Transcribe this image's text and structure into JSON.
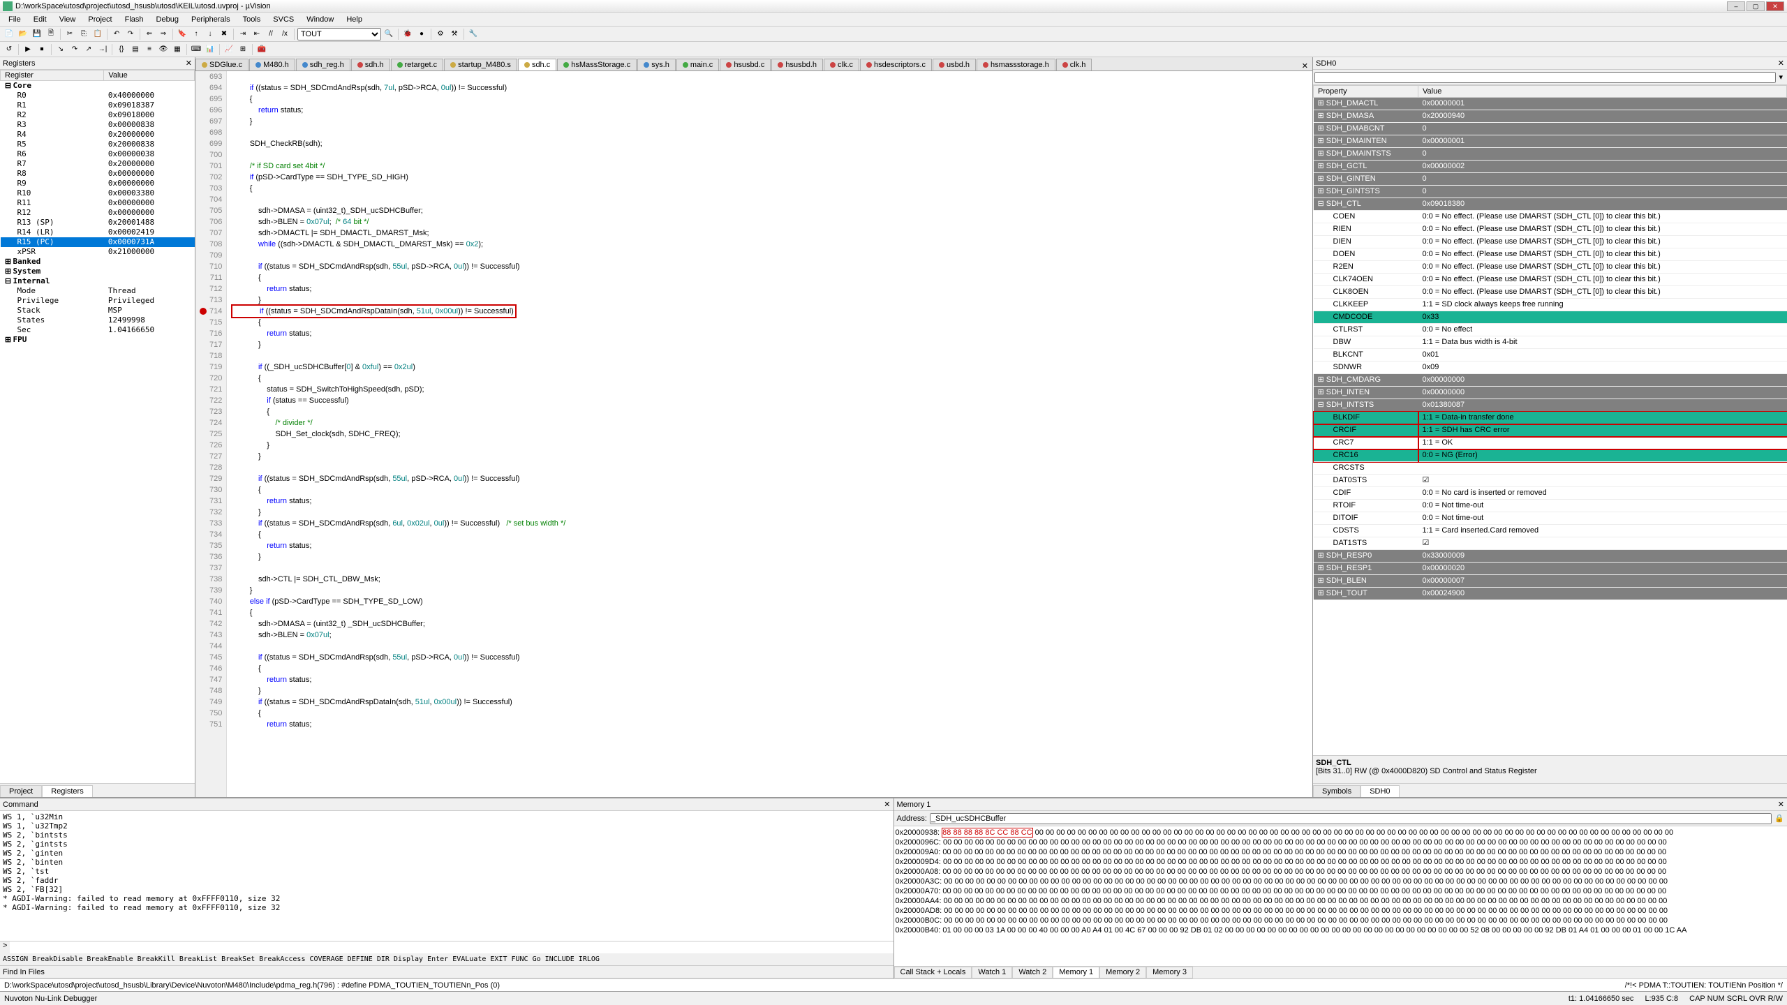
{
  "title": "D:\\workSpace\\utosd\\project\\utosd_hsusb\\utosd\\KEIL\\utosd.uvproj - µVision",
  "menu": [
    "File",
    "Edit",
    "View",
    "Project",
    "Flash",
    "Debug",
    "Peripherals",
    "Tools",
    "SVCS",
    "Window",
    "Help"
  ],
  "toolbar_dropdown": "TOUT",
  "registers_panel": {
    "title": "Registers",
    "columns": [
      "Register",
      "Value"
    ],
    "groups": [
      {
        "name": "Core",
        "items": [
          {
            "r": "R0",
            "v": "0x40000000"
          },
          {
            "r": "R1",
            "v": "0x09018387"
          },
          {
            "r": "R2",
            "v": "0x09018000"
          },
          {
            "r": "R3",
            "v": "0x00000838"
          },
          {
            "r": "R4",
            "v": "0x20000000"
          },
          {
            "r": "R5",
            "v": "0x20000838"
          },
          {
            "r": "R6",
            "v": "0x00000038"
          },
          {
            "r": "R7",
            "v": "0x20000000"
          },
          {
            "r": "R8",
            "v": "0x00000000"
          },
          {
            "r": "R9",
            "v": "0x00000000"
          },
          {
            "r": "R10",
            "v": "0x00003380"
          },
          {
            "r": "R11",
            "v": "0x00000000"
          },
          {
            "r": "R12",
            "v": "0x00000000"
          },
          {
            "r": "R13 (SP)",
            "v": "0x20001488"
          },
          {
            "r": "R14 (LR)",
            "v": "0x00002419"
          },
          {
            "r": "R15 (PC)",
            "v": "0x0000731A",
            "sel": true
          },
          {
            "r": "xPSR",
            "v": "0x21000000"
          }
        ]
      },
      {
        "name": "Banked",
        "items": []
      },
      {
        "name": "System",
        "items": []
      },
      {
        "name": "Internal",
        "items": [
          {
            "r": "Mode",
            "v": "Thread"
          },
          {
            "r": "Privilege",
            "v": "Privileged"
          },
          {
            "r": "Stack",
            "v": "MSP"
          },
          {
            "r": "States",
            "v": "12499998"
          },
          {
            "r": "Sec",
            "v": "1.04166650"
          }
        ]
      },
      {
        "name": "FPU",
        "items": []
      }
    ],
    "bottom_tabs": [
      "Project",
      "Registers"
    ],
    "bottom_active": 1
  },
  "file_tabs": [
    {
      "label": "SDGlue.c",
      "color": "y"
    },
    {
      "label": "M480.h",
      "color": "b"
    },
    {
      "label": "sdh_reg.h",
      "color": "b"
    },
    {
      "label": "sdh.h",
      "color": "r"
    },
    {
      "label": "retarget.c",
      "color": "g"
    },
    {
      "label": "startup_M480.s",
      "color": "y"
    },
    {
      "label": "sdh.c",
      "color": "y",
      "active": true
    },
    {
      "label": "hsMassStorage.c",
      "color": "g"
    },
    {
      "label": "sys.h",
      "color": "b"
    },
    {
      "label": "main.c",
      "color": "g"
    },
    {
      "label": "hsusbd.c",
      "color": "r"
    },
    {
      "label": "hsusbd.h",
      "color": "r"
    },
    {
      "label": "clk.c",
      "color": "r"
    },
    {
      "label": "hsdescriptors.c",
      "color": "r"
    },
    {
      "label": "usbd.h",
      "color": "r"
    },
    {
      "label": "hsmassstorage.h",
      "color": "r"
    },
    {
      "label": "clk.h",
      "color": "r"
    }
  ],
  "code_lines": [
    {
      "n": 693
    },
    {
      "n": 694,
      "t": "        if ((status = SDH_SDCmdAndRsp(sdh, 7ul, pSD->RCA, 0ul)) != Successful)"
    },
    {
      "n": 695,
      "t": "        {"
    },
    {
      "n": 696,
      "t": "            return status;"
    },
    {
      "n": 697,
      "t": "        }"
    },
    {
      "n": 698
    },
    {
      "n": 699,
      "t": "        SDH_CheckRB(sdh);"
    },
    {
      "n": 700
    },
    {
      "n": 701,
      "t": "        /* if SD card set 4bit */",
      "c": true
    },
    {
      "n": 702,
      "t": "        if (pSD->CardType == SDH_TYPE_SD_HIGH)"
    },
    {
      "n": 703,
      "t": "        {"
    },
    {
      "n": 704
    },
    {
      "n": 705,
      "t": "            sdh->DMASA = (uint32_t)_SDH_ucSDHCBuffer;"
    },
    {
      "n": 706,
      "t": "            sdh->BLEN = 0x07ul;  /* 64 bit */"
    },
    {
      "n": 707,
      "t": "            sdh->DMACTL |= SDH_DMACTL_DMARST_Msk;"
    },
    {
      "n": 708,
      "t": "            while ((sdh->DMACTL & SDH_DMACTL_DMARST_Msk) == 0x2);"
    },
    {
      "n": 709
    },
    {
      "n": 710,
      "t": "            if ((status = SDH_SDCmdAndRsp(sdh, 55ul, pSD->RCA, 0ul)) != Successful)"
    },
    {
      "n": 711,
      "t": "            {"
    },
    {
      "n": 712,
      "t": "                return status;"
    },
    {
      "n": 713,
      "t": "            }"
    },
    {
      "n": 714,
      "t": "            if ((status = SDH_SDCmdAndRspDataIn(sdh, 51ul, 0x00ul)) != Successful)",
      "bp": true,
      "box": true
    },
    {
      "n": 715,
      "t": "            {"
    },
    {
      "n": 716,
      "t": "                return status;"
    },
    {
      "n": 717,
      "t": "            }"
    },
    {
      "n": 718
    },
    {
      "n": 719,
      "t": "            if ((_SDH_ucSDHCBuffer[0] & 0xful) == 0x2ul)"
    },
    {
      "n": 720,
      "t": "            {"
    },
    {
      "n": 721,
      "t": "                status = SDH_SwitchToHighSpeed(sdh, pSD);"
    },
    {
      "n": 722,
      "t": "                if (status == Successful)"
    },
    {
      "n": 723,
      "t": "                {"
    },
    {
      "n": 724,
      "t": "                    /* divider */",
      "c": true
    },
    {
      "n": 725,
      "t": "                    SDH_Set_clock(sdh, SDHC_FREQ);"
    },
    {
      "n": 726,
      "t": "                }"
    },
    {
      "n": 727,
      "t": "            }"
    },
    {
      "n": 728
    },
    {
      "n": 729,
      "t": "            if ((status = SDH_SDCmdAndRsp(sdh, 55ul, pSD->RCA, 0ul)) != Successful)"
    },
    {
      "n": 730,
      "t": "            {"
    },
    {
      "n": 731,
      "t": "                return status;"
    },
    {
      "n": 732,
      "t": "            }"
    },
    {
      "n": 733,
      "t": "            if ((status = SDH_SDCmdAndRsp(sdh, 6ul, 0x02ul, 0ul)) != Successful)   /* set bus width */"
    },
    {
      "n": 734,
      "t": "            {"
    },
    {
      "n": 735,
      "t": "                return status;"
    },
    {
      "n": 736,
      "t": "            }"
    },
    {
      "n": 737
    },
    {
      "n": 738,
      "t": "            sdh->CTL |= SDH_CTL_DBW_Msk;"
    },
    {
      "n": 739,
      "t": "        }"
    },
    {
      "n": 740,
      "t": "        else if (pSD->CardType == SDH_TYPE_SD_LOW)"
    },
    {
      "n": 741,
      "t": "        {"
    },
    {
      "n": 742,
      "t": "            sdh->DMASA = (uint32_t) _SDH_ucSDHCBuffer;"
    },
    {
      "n": 743,
      "t": "            sdh->BLEN = 0x07ul;"
    },
    {
      "n": 744
    },
    {
      "n": 745,
      "t": "            if ((status = SDH_SDCmdAndRsp(sdh, 55ul, pSD->RCA, 0ul)) != Successful)"
    },
    {
      "n": 746,
      "t": "            {"
    },
    {
      "n": 747,
      "t": "                return status;"
    },
    {
      "n": 748,
      "t": "            }"
    },
    {
      "n": 749,
      "t": "            if ((status = SDH_SDCmdAndRspDataIn(sdh, 51ul, 0x00ul)) != Successful)"
    },
    {
      "n": 750,
      "t": "            {"
    },
    {
      "n": 751,
      "t": "                return status;"
    }
  ],
  "sdh_panel": {
    "title": "SDH0",
    "columns": [
      "Property",
      "Value"
    ],
    "rows": [
      {
        "p": "SDH_DMACTL",
        "v": "0x00000001",
        "s": true
      },
      {
        "p": "SDH_DMASA",
        "v": "0x20000940",
        "s": true
      },
      {
        "p": "SDH_DMABCNT",
        "v": "0",
        "s": true
      },
      {
        "p": "SDH_DMAINTEN",
        "v": "0x00000001",
        "s": true
      },
      {
        "p": "SDH_DMAINTSTS",
        "v": "0",
        "s": true
      },
      {
        "p": "SDH_GCTL",
        "v": "0x00000002",
        "s": true
      },
      {
        "p": "SDH_GINTEN",
        "v": "0",
        "s": true
      },
      {
        "p": "SDH_GINTSTS",
        "v": "0",
        "s": true
      },
      {
        "p": "SDH_CTL",
        "v": "0x09018380",
        "s": true,
        "exp": true
      },
      {
        "p": "COEN",
        "v": "0:0 = No effect. (Please use DMARST (SDH_CTL [0]) to clear this bit.)",
        "i": true
      },
      {
        "p": "RIEN",
        "v": "0:0 = No effect. (Please use DMARST (SDH_CTL [0]) to clear this bit.)",
        "i": true
      },
      {
        "p": "DIEN",
        "v": "0:0 = No effect. (Please use DMARST (SDH_CTL [0]) to clear this bit.)",
        "i": true
      },
      {
        "p": "DOEN",
        "v": "0:0 = No effect. (Please use DMARST (SDH_CTL [0]) to clear this bit.)",
        "i": true
      },
      {
        "p": "R2EN",
        "v": "0:0 = No effect. (Please use DMARST (SDH_CTL [0]) to clear this bit.)",
        "i": true
      },
      {
        "p": "CLK74OEN",
        "v": "0:0 = No effect. (Please use DMARST (SDH_CTL [0]) to clear this bit.)",
        "i": true
      },
      {
        "p": "CLK8OEN",
        "v": "0:0 = No effect. (Please use DMARST (SDH_CTL [0]) to clear this bit.)",
        "i": true
      },
      {
        "p": "CLKKEEP",
        "v": "1:1 = SD clock always keeps free running",
        "i": true
      },
      {
        "p": "CMDCODE",
        "v": "0x33",
        "i": true,
        "hl": true
      },
      {
        "p": "CTLRST",
        "v": "0:0 = No effect",
        "i": true
      },
      {
        "p": "DBW",
        "v": "1:1 = Data bus width is 4-bit",
        "i": true
      },
      {
        "p": "BLKCNT",
        "v": "0x01",
        "i": true
      },
      {
        "p": "SDNWR",
        "v": "0x09",
        "i": true
      },
      {
        "p": "SDH_CMDARG",
        "v": "0x00000000",
        "s": true
      },
      {
        "p": "SDH_INTEN",
        "v": "0x00000000",
        "s": true
      },
      {
        "p": "SDH_INTSTS",
        "v": "0x01380087",
        "s": true,
        "exp": true
      },
      {
        "p": "BLKDIF",
        "v": "1:1 = Data-in transfer done",
        "i": true,
        "hl": true,
        "rb": true
      },
      {
        "p": "CRCIF",
        "v": "1:1 = SDH has CRC error",
        "i": true,
        "hl": true,
        "rb": true
      },
      {
        "p": "CRC7",
        "v": "1:1 = OK",
        "i": true,
        "rb": true
      },
      {
        "p": "CRC16",
        "v": "0:0 = NG (Error)",
        "i": true,
        "hl": true,
        "rb": true
      },
      {
        "p": "CRCSTS",
        "v": "",
        "i": true
      },
      {
        "p": "DAT0STS",
        "v": "☑",
        "i": true
      },
      {
        "p": "CDIF",
        "v": "0:0 = No card is inserted or removed",
        "i": true
      },
      {
        "p": "RTOIF",
        "v": "0:0 = Not time-out",
        "i": true
      },
      {
        "p": "DITOIF",
        "v": "0:0 = Not time-out",
        "i": true
      },
      {
        "p": "CDSTS",
        "v": "1:1 = Card inserted.Card removed",
        "i": true
      },
      {
        "p": "DAT1STS",
        "v": "☑",
        "i": true
      },
      {
        "p": "SDH_RESP0",
        "v": "0x33000009",
        "s": true
      },
      {
        "p": "SDH_RESP1",
        "v": "0x00000020",
        "s": true
      },
      {
        "p": "SDH_BLEN",
        "v": "0x00000007",
        "s": true
      },
      {
        "p": "SDH_TOUT",
        "v": "0x00024900",
        "s": true
      }
    ],
    "desc_name": "SDH_CTL",
    "desc_text": "[Bits 31..0] RW (@ 0x4000D820) SD Control and Status Register",
    "bottom_tabs": [
      "Symbols",
      "SDH0"
    ],
    "bottom_active": 1
  },
  "find_files": "Find In Files",
  "command_panel": {
    "title": "Command",
    "lines": [
      "WS 1, `u32Min",
      "WS 1, `u32Tmp2",
      "WS 2, `bintsts",
      "WS 2, `gintsts",
      "WS 2, `ginten",
      "WS 2, `binten",
      "WS 2, `tst",
      "WS 2, `faddr",
      "WS 2, `FB[32]",
      "* AGDI-Warning: failed to read memory at 0xFFFF0110, size 32",
      "* AGDI-Warning: failed to read memory at 0xFFFF0110, size 32",
      ""
    ],
    "prompt": ">",
    "hint": "ASSIGN BreakDisable BreakEnable BreakKill BreakList BreakSet BreakAccess COVERAGE DEFINE DIR Display Enter EVALuate EXIT FUNC Go INCLUDE IRLOG"
  },
  "memory_panel": {
    "title": "Memory 1",
    "address_label": "Address:",
    "address_value": "_SDH_ucSDHCBuffer",
    "lines": [
      {
        "a": "0x20000938:",
        "d": "88 88 88 88 8C CC 88 CC",
        "d2": " 00 00 00 00 00 00 00 00 00 00 00 00 00 00 00 00 00 00 00 00 00 00 00 00 00 00 00 00 00 00 00 00 00 00 00 00 00 00 00 00 00 00 00 00 00 00 00 00 00 00 00 00 00 00 00 00 00 00 00 00",
        "hl": true
      },
      {
        "a": "0x2000096C:",
        "d": "00 00 00 00 00 00 00 00 00 00 00 00 00 00 00 00 00 00 00 00 00 00 00 00 00 00 00 00 00 00 00 00 00 00 00 00 00 00 00 00 00 00 00 00 00 00 00 00 00 00 00 00 00 00 00 00 00 00 00 00 00 00 00 00 00 00 00 00"
      },
      {
        "a": "0x200009A0:",
        "d": "00 00 00 00 00 00 00 00 00 00 00 00 00 00 00 00 00 00 00 00 00 00 00 00 00 00 00 00 00 00 00 00 00 00 00 00 00 00 00 00 00 00 00 00 00 00 00 00 00 00 00 00 00 00 00 00 00 00 00 00 00 00 00 00 00 00 00 00"
      },
      {
        "a": "0x200009D4:",
        "d": "00 00 00 00 00 00 00 00 00 00 00 00 00 00 00 00 00 00 00 00 00 00 00 00 00 00 00 00 00 00 00 00 00 00 00 00 00 00 00 00 00 00 00 00 00 00 00 00 00 00 00 00 00 00 00 00 00 00 00 00 00 00 00 00 00 00 00 00"
      },
      {
        "a": "0x20000A08:",
        "d": "00 00 00 00 00 00 00 00 00 00 00 00 00 00 00 00 00 00 00 00 00 00 00 00 00 00 00 00 00 00 00 00 00 00 00 00 00 00 00 00 00 00 00 00 00 00 00 00 00 00 00 00 00 00 00 00 00 00 00 00 00 00 00 00 00 00 00 00"
      },
      {
        "a": "0x20000A3C:",
        "d": "00 00 00 00 00 00 00 00 00 00 00 00 00 00 00 00 00 00 00 00 00 00 00 00 00 00 00 00 00 00 00 00 00 00 00 00 00 00 00 00 00 00 00 00 00 00 00 00 00 00 00 00 00 00 00 00 00 00 00 00 00 00 00 00 00 00 00 00"
      },
      {
        "a": "0x20000A70:",
        "d": "00 00 00 00 00 00 00 00 00 00 00 00 00 00 00 00 00 00 00 00 00 00 00 00 00 00 00 00 00 00 00 00 00 00 00 00 00 00 00 00 00 00 00 00 00 00 00 00 00 00 00 00 00 00 00 00 00 00 00 00 00 00 00 00 00 00 00 00"
      },
      {
        "a": "0x20000AA4:",
        "d": "00 00 00 00 00 00 00 00 00 00 00 00 00 00 00 00 00 00 00 00 00 00 00 00 00 00 00 00 00 00 00 00 00 00 00 00 00 00 00 00 00 00 00 00 00 00 00 00 00 00 00 00 00 00 00 00 00 00 00 00 00 00 00 00 00 00 00 00"
      },
      {
        "a": "0x20000AD8:",
        "d": "00 00 00 00 00 00 00 00 00 00 00 00 00 00 00 00 00 00 00 00 00 00 00 00 00 00 00 00 00 00 00 00 00 00 00 00 00 00 00 00 00 00 00 00 00 00 00 00 00 00 00 00 00 00 00 00 00 00 00 00 00 00 00 00 00 00 00 00"
      },
      {
        "a": "0x20000B0C:",
        "d": "00 00 00 00 00 00 00 00 00 00 00 00 00 00 00 00 00 00 00 00 00 00 00 00 00 00 00 00 00 00 00 00 00 00 00 00 00 00 00 00 00 00 00 00 00 00 00 00 00 00 00 00 00 00 00 00 00 00 00 00 00 00 00 00 00 00 00 00"
      },
      {
        "a": "0x20000B40:",
        "d": "01 00 00 00 03 1A 00 00 00 40 00 00 00 A0 A4 01 00 4C 67 00 00 00 92 DB 01 02 00 00 00 00 00 00 00 00 00 00 00 00 00 00 00 00 00 00 00 00 00 00 00 52 08 00 00 00 00 00 92 DB 01 A4 01 00 00 00 01 00 00 1C AA"
      }
    ],
    "tabs": [
      "Call Stack + Locals",
      "Watch 1",
      "Watch 2",
      "Memory 1",
      "Memory 2",
      "Memory 3"
    ],
    "active_tab": 3
  },
  "status_line": {
    "left": "D:\\workSpace\\utosd\\project\\utosd_hsusb\\Library\\Device\\Nuvoton\\M480\\Include\\pdma_reg.h(796) : #define PDMA_TOUTIEN_TOUTIENn_Pos        (0)",
    "right": "/*!< PDMA T::TOUTIEN: TOUTIENn Position     */"
  },
  "statusbar": {
    "left": "Nuvoton Nu-Link Debugger",
    "time": "t1: 1.04166650 sec",
    "pos": "L:935 C:8",
    "caps": "CAP NUM SCRL OVR R/W"
  }
}
